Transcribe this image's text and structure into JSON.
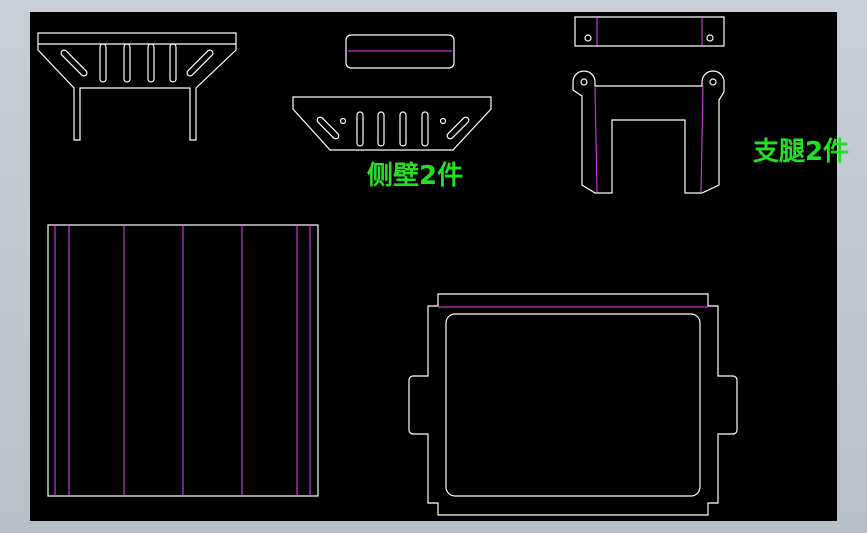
{
  "labels": {
    "side_wall": "侧壁2件",
    "support_leg": "支腿2件"
  },
  "colors": {
    "outline": "#ffffff",
    "fold_line": "#c832d2",
    "label": "#22e022",
    "background": "#000000"
  }
}
